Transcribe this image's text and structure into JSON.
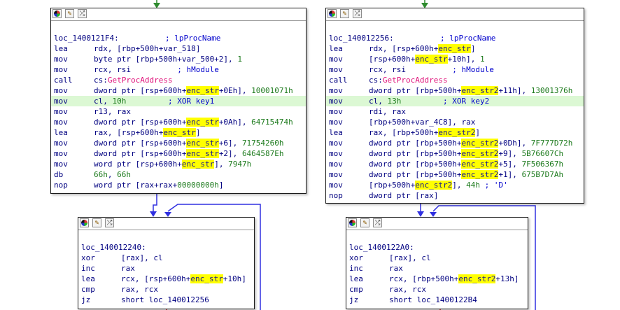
{
  "nodes": [
    {
      "id": "A",
      "lines": [
        {
          "blank": true
        },
        {
          "label": "loc_1400121F4:",
          "comment": "; lpProcName"
        },
        {
          "mn": "lea",
          "parts": [
            [
              "t",
              "rdx, [rbp+500h+var_518]"
            ]
          ]
        },
        {
          "mn": "mov",
          "parts": [
            [
              "t",
              "byte ptr [rbp+500h+var_500+2], "
            ],
            [
              "n",
              "1"
            ]
          ]
        },
        {
          "mn": "mov",
          "parts": [
            [
              "t",
              "rcx, rsi          "
            ],
            [
              "c",
              "; hModule"
            ]
          ]
        },
        {
          "mn": "call",
          "parts": [
            [
              "t",
              "cs:"
            ],
            [
              "i",
              "GetProcAddress"
            ]
          ]
        },
        {
          "mn": "mov",
          "parts": [
            [
              "t",
              "dword ptr [rsp+600h+"
            ],
            [
              "y",
              "enc_str"
            ],
            [
              "t",
              "+0Eh], "
            ],
            [
              "n",
              "10001071h"
            ]
          ]
        },
        {
          "mn": "mov",
          "hl": true,
          "parts": [
            [
              "t",
              "cl, "
            ],
            [
              "n",
              "10h"
            ],
            [
              "t",
              "         "
            ],
            [
              "c",
              "; XOR key1"
            ]
          ]
        },
        {
          "mn": "mov",
          "parts": [
            [
              "t",
              "r13, rax"
            ]
          ]
        },
        {
          "mn": "mov",
          "parts": [
            [
              "t",
              "dword ptr [rsp+600h+"
            ],
            [
              "y",
              "enc_str"
            ],
            [
              "t",
              "+0Ah], "
            ],
            [
              "n",
              "64715474h"
            ]
          ]
        },
        {
          "mn": "lea",
          "parts": [
            [
              "t",
              "rax, [rsp+600h+"
            ],
            [
              "y",
              "enc_str"
            ],
            [
              "t",
              "]"
            ]
          ]
        },
        {
          "mn": "mov",
          "parts": [
            [
              "t",
              "dword ptr [rsp+600h+"
            ],
            [
              "y",
              "enc_str"
            ],
            [
              "t",
              "+6], "
            ],
            [
              "n",
              "71754260h"
            ]
          ]
        },
        {
          "mn": "mov",
          "parts": [
            [
              "t",
              "dword ptr [rsp+600h+"
            ],
            [
              "y",
              "enc_str"
            ],
            [
              "t",
              "+2], "
            ],
            [
              "n",
              "6464587Eh"
            ]
          ]
        },
        {
          "mn": "mov",
          "parts": [
            [
              "t",
              "word ptr [rsp+600h+"
            ],
            [
              "y",
              "enc_str"
            ],
            [
              "t",
              "], "
            ],
            [
              "n",
              "7947h"
            ]
          ]
        },
        {
          "mn": "db",
          "parts": [
            [
              "n",
              "66h"
            ],
            [
              "t",
              ", "
            ],
            [
              "n",
              "66h"
            ]
          ]
        },
        {
          "mn": "nop",
          "parts": [
            [
              "t",
              "word ptr [rax+rax+"
            ],
            [
              "n",
              "00000000h"
            ],
            [
              "t",
              "]"
            ]
          ]
        }
      ]
    },
    {
      "id": "B",
      "lines": [
        {
          "blank": true
        },
        {
          "label": "loc_140012256:",
          "comment": "; lpProcName"
        },
        {
          "mn": "lea",
          "parts": [
            [
              "t",
              "rdx, [rsp+600h+"
            ],
            [
              "y",
              "enc_str"
            ],
            [
              "t",
              "]"
            ]
          ]
        },
        {
          "mn": "mov",
          "parts": [
            [
              "t",
              "[rsp+600h+"
            ],
            [
              "y",
              "enc_str"
            ],
            [
              "t",
              "+10h], "
            ],
            [
              "n",
              "1"
            ]
          ]
        },
        {
          "mn": "mov",
          "parts": [
            [
              "t",
              "rcx, rsi          "
            ],
            [
              "c",
              "; hModule"
            ]
          ]
        },
        {
          "mn": "call",
          "parts": [
            [
              "t",
              "cs:"
            ],
            [
              "i",
              "GetProcAddress"
            ]
          ]
        },
        {
          "mn": "mov",
          "parts": [
            [
              "t",
              "dword ptr [rbp+500h+"
            ],
            [
              "y",
              "enc_str2"
            ],
            [
              "t",
              "+11h], "
            ],
            [
              "n",
              "13001376h"
            ]
          ]
        },
        {
          "mn": "mov",
          "hl": true,
          "parts": [
            [
              "t",
              "cl, "
            ],
            [
              "n",
              "13h"
            ],
            [
              "t",
              "         "
            ],
            [
              "c",
              "; XOR key2"
            ]
          ]
        },
        {
          "mn": "mov",
          "parts": [
            [
              "t",
              "rdi, rax"
            ]
          ]
        },
        {
          "mn": "mov",
          "parts": [
            [
              "t",
              "[rbp+500h+var_4C8], rax"
            ]
          ]
        },
        {
          "mn": "lea",
          "parts": [
            [
              "t",
              "rax, [rbp+500h+"
            ],
            [
              "y",
              "enc_str2"
            ],
            [
              "t",
              "]"
            ]
          ]
        },
        {
          "mn": "mov",
          "parts": [
            [
              "t",
              "dword ptr [rbp+500h+"
            ],
            [
              "y",
              "enc_str2"
            ],
            [
              "t",
              "+0Dh], "
            ],
            [
              "n",
              "7F777D72h"
            ]
          ]
        },
        {
          "mn": "mov",
          "parts": [
            [
              "t",
              "dword ptr [rbp+500h+"
            ],
            [
              "y",
              "enc_str2"
            ],
            [
              "t",
              "+9], "
            ],
            [
              "n",
              "5B76607Ch"
            ]
          ]
        },
        {
          "mn": "mov",
          "parts": [
            [
              "t",
              "dword ptr [rbp+500h+"
            ],
            [
              "y",
              "enc_str2"
            ],
            [
              "t",
              "+5], "
            ],
            [
              "n",
              "7F506367h"
            ]
          ]
        },
        {
          "mn": "mov",
          "parts": [
            [
              "t",
              "dword ptr [rbp+500h+"
            ],
            [
              "y",
              "enc_str2"
            ],
            [
              "t",
              "+1], "
            ],
            [
              "n",
              "675B7D7Ah"
            ]
          ]
        },
        {
          "mn": "mov",
          "parts": [
            [
              "t",
              "[rbp+500h+"
            ],
            [
              "y",
              "enc_str2"
            ],
            [
              "t",
              "], "
            ],
            [
              "n",
              "44h"
            ],
            [
              "t",
              " "
            ],
            [
              "c",
              "; 'D'"
            ]
          ]
        },
        {
          "mn": "nop",
          "parts": [
            [
              "t",
              "dword ptr [rax]"
            ]
          ]
        }
      ]
    },
    {
      "id": "C",
      "lines": [
        {
          "blank": true
        },
        {
          "label": "loc_140012240:"
        },
        {
          "mn": "xor",
          "parts": [
            [
              "t",
              "[rax], cl"
            ]
          ]
        },
        {
          "mn": "inc",
          "parts": [
            [
              "t",
              "rax"
            ]
          ]
        },
        {
          "mn": "lea",
          "parts": [
            [
              "t",
              "rcx, [rsp+600h+"
            ],
            [
              "y",
              "enc_str"
            ],
            [
              "t",
              "+10h]"
            ]
          ]
        },
        {
          "mn": "cmp",
          "parts": [
            [
              "t",
              "rax, rcx"
            ]
          ]
        },
        {
          "mn": "jz",
          "parts": [
            [
              "t",
              "short loc_140012256"
            ]
          ]
        }
      ]
    },
    {
      "id": "D",
      "lines": [
        {
          "blank": true
        },
        {
          "label": "loc_1400122A0:"
        },
        {
          "mn": "xor",
          "parts": [
            [
              "t",
              "[rax], cl"
            ]
          ]
        },
        {
          "mn": "inc",
          "parts": [
            [
              "t",
              "rax"
            ]
          ]
        },
        {
          "mn": "lea",
          "parts": [
            [
              "t",
              "rcx, [rbp+500h+"
            ],
            [
              "y",
              "enc_str2"
            ],
            [
              "t",
              "+13h]"
            ]
          ]
        },
        {
          "mn": "cmp",
          "parts": [
            [
              "t",
              "rax, rcx"
            ]
          ]
        },
        {
          "mn": "jz",
          "parts": [
            [
              "t",
              "short loc_1400122B4"
            ]
          ]
        }
      ]
    }
  ],
  "header_icons": [
    "color-palette-icon",
    "rename-pencil-icon",
    "graph-overview-icon"
  ],
  "colors": {
    "mnemonic": "#000080",
    "number": "#1e7b1e",
    "import": "#e0137b",
    "highlight_bg": "#dcf8d4",
    "highlight_token": "#ffff00",
    "edge_green": "#2e8b2e",
    "edge_blue": "#3030e0"
  }
}
